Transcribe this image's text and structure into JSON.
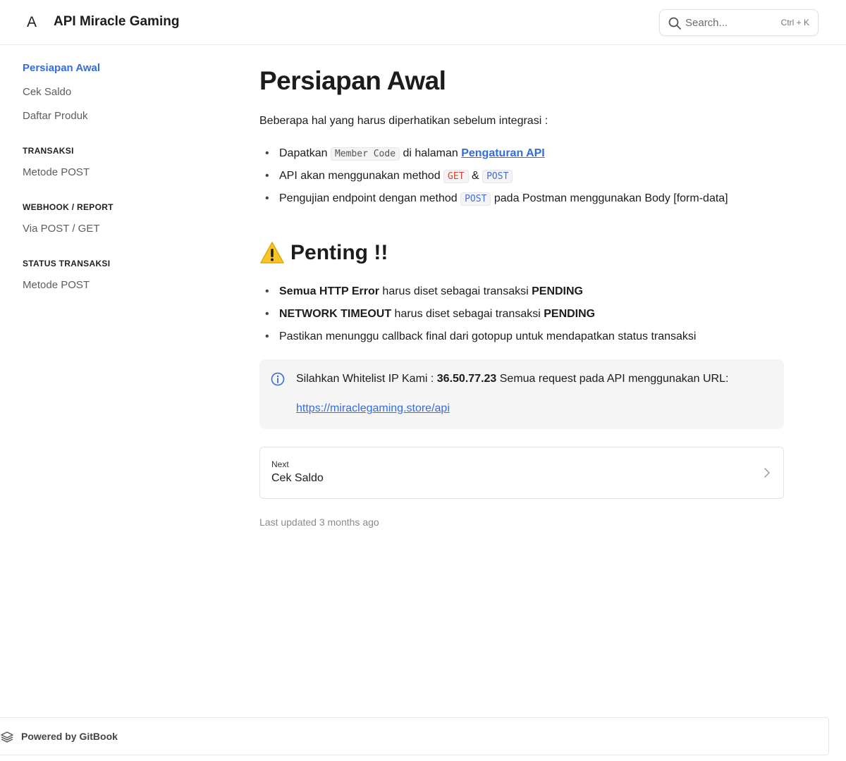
{
  "header": {
    "logo_letter": "A",
    "site_title": "API Miracle Gaming",
    "search_placeholder": "Search...",
    "search_shortcut": "Ctrl + K"
  },
  "sidebar": {
    "top_items": [
      {
        "label": "Persiapan Awal",
        "active": true
      },
      {
        "label": "Cek Saldo",
        "active": false
      },
      {
        "label": "Daftar Produk",
        "active": false
      }
    ],
    "sections": [
      {
        "heading": "TRANSAKSI",
        "items": [
          "Metode POST"
        ]
      },
      {
        "heading": "WEBHOOK / REPORT",
        "items": [
          "Via POST / GET"
        ]
      },
      {
        "heading": "STATUS TRANSAKSI",
        "items": [
          "Metode POST"
        ]
      }
    ]
  },
  "main": {
    "title": "Persiapan Awal",
    "intro": "Beberapa hal yang harus diperhatikan sebelum integrasi :",
    "bullets1": {
      "b1_pre": "Dapatkan ",
      "b1_code": "Member Code",
      "b1_mid": " di halaman ",
      "b1_link": "Pengaturan API",
      "b2_pre": "API akan menggunakan method ",
      "b2_code1": "GET",
      "b2_amp": " & ",
      "b2_code2": "POST",
      "b3_pre": "Pengujian endpoint dengan method ",
      "b3_code": "POST",
      "b3_post": " pada Postman menggunakan Body [form-data]"
    },
    "h2": "Penting !!",
    "bullets2": {
      "b1_bold": "Semua HTTP Error",
      "b1_mid": " harus diset sebagai transaksi ",
      "b1_bold2": "PENDING",
      "b2_bold": "NETWORK TIMEOUT",
      "b2_mid": " harus diset sebagai transaksi ",
      "b2_bold2": "PENDING",
      "b3_text": "Pastikan menunggu callback final dari gotopup untuk mendapatkan status transaksi"
    },
    "hint": {
      "pre": "Silahkan Whitelist IP Kami : ",
      "ip": "36.50.77.23",
      "post": " Semua request pada API menggunakan URL:",
      "url": "https://miraclegaming.store/api"
    },
    "next": {
      "label": "Next",
      "title": "Cek Saldo"
    },
    "last_updated": "Last updated 3 months ago"
  },
  "footer": {
    "powered_by": "Powered by GitBook"
  },
  "colors": {
    "accent": "#346ddb",
    "code_red": "#d0433b",
    "code_blue": "#3e6fd8",
    "hint_bg": "#f5f5f5"
  }
}
